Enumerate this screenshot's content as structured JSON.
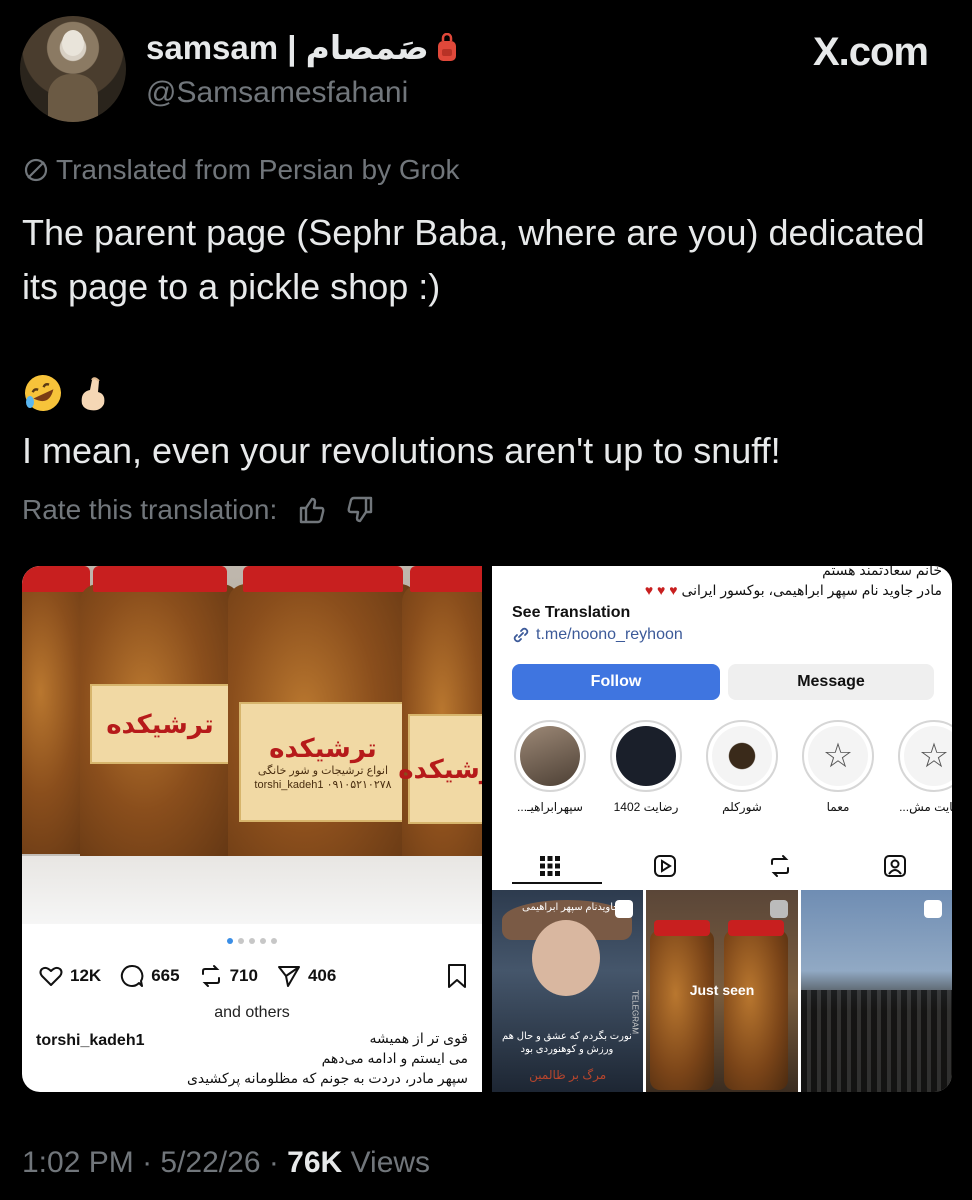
{
  "header": {
    "display_name": "samsam | صَمصام",
    "handle": "@Samsamesfahani",
    "site": "X.com"
  },
  "translation": {
    "notice": "Translated from Persian by Grok",
    "rate_label": "Rate this translation:"
  },
  "tweet": {
    "text_1": "The parent page (Sephr Baba, where are you) dedicated its page to a pickle shop :)",
    "emojis": [
      "rolling-on-floor-laughing",
      "pinching-hand"
    ],
    "text_2": "I mean, even your revolutions aren't up to snuff!"
  },
  "left_post": {
    "jar_label_title": "ترشیکده",
    "jar_label_sub": "انواع ترشیجات و شور خانگی",
    "jar_label_phone": "torshi_kadeh1 ۰۹۱۰۵۲۱۰۲۷۸",
    "carousel_pages": 5,
    "carousel_active": 1,
    "likes": "12K",
    "comments": "665",
    "reposts": "710",
    "shares": "406",
    "and_others": "and others",
    "username": "torshi_kadeh1",
    "caption_lines": [
      "قوی تر از همیشه",
      "می ایستم و ادامه می‌دهم",
      "سپهر مادر، دردت به جونم که مظلومانه پرکشیدی"
    ]
  },
  "right_profile": {
    "bio_line_1": "خانم سعادتمند هستم",
    "bio_line_2": "مادر جاوید نام سپهر ابراهیمی، بوکسور ایرانی",
    "see_translation": "See Translation",
    "link": "t.me/noono_reyhoon",
    "follow_label": "Follow",
    "message_label": "Message",
    "highlights": [
      {
        "label": "سپهرابراهیـ...",
        "color": "#6a5a4a"
      },
      {
        "label": "رضایت 1402",
        "color": "#1a1f2a"
      },
      {
        "label": "شورکلم",
        "color": "#f4f4f4"
      },
      {
        "label": "معما",
        "color": "#f4f4f4"
      },
      {
        "label": "رضایت مش...",
        "color": "#f4f4f4"
      }
    ],
    "grid": [
      {
        "overlay_title": "#جاویدنام سپهر ابراهیمی",
        "overlay_text": "نورت بگردم که عشق و حال هم ورزش و کوهنوردی بود",
        "red_text": "مرگ بر ظالمین",
        "watermark": "TELEGRAM"
      },
      {
        "overlay_text": "Just seen"
      },
      {
        "overlay_text": ""
      }
    ]
  },
  "meta": {
    "time": "1:02 PM",
    "date": "5/22/26",
    "views_count": "76K",
    "views_label": "Views"
  },
  "colors": {
    "background": "#000000",
    "text_primary": "#e7e9ea",
    "text_secondary": "#71767b",
    "follow_blue": "#3f75e0"
  }
}
